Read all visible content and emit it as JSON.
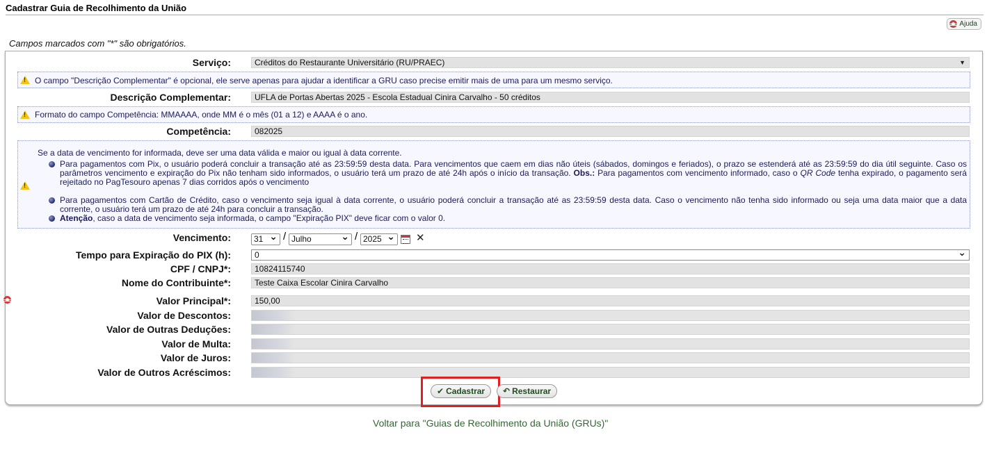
{
  "page": {
    "title": "Cadastrar Guia de Recolhimento da União",
    "help_label": "Ajuda",
    "required_note": "Campos marcados com \"*\" são obrigatórios."
  },
  "form": {
    "servico": {
      "label": "Serviço:",
      "value": "Créditos do Restaurante Universitário (RU/PRAEC)"
    },
    "info_descricao": "O campo \"Descrição Complementar\" é opcional, ele serve apenas para ajudar a identificar a GRU caso precise emitir mais de uma para um mesmo serviço.",
    "descricao": {
      "label": "Descrição Complementar:",
      "value": "UFLA de Portas Abertas 2025 - Escola Estadual Cinira Carvalho - 50 créditos"
    },
    "info_competencia": "Formato do campo Competência: MMAAAA, onde MM é o mês (01 a 12) e AAAA é o ano.",
    "competencia": {
      "label": "Competência:",
      "value": "082025"
    },
    "vencimento_info": {
      "intro": "Se a data de vencimento for informada, deve ser uma data válida e maior ou igual à data corrente.",
      "pix_a": "Para pagamentos com Pix, o usuário poderá concluir a transação até as 23:59:59 desta data. Para vencimentos que caem em dias não úteis (sábados, domingos e feriados), o prazo se estenderá até as 23:59:59 do dia útil seguinte. Caso os parâmetros vencimento e expiração do Pix não tenham sido informados, o usuário terá um prazo de até 24h após o início da transação. ",
      "pix_obs": "Obs.:",
      "pix_b": " Para pagamentos com vencimento informado, caso o ",
      "pix_qr": "QR Code",
      "pix_c": " tenha expirado, o pagamento será rejeitado no PagTesouro apenas 7 dias corridos após o vencimento",
      "cartao": "Para pagamentos com Cartão de Crédito, caso o vencimento seja igual à data corrente, o usuário poderá concluir a transação até as 23:59:59 desta data. Caso o vencimento não tenha sido informado ou seja uma data maior que a data corrente, o usuário terá um prazo de até 24h para concluir a transação.",
      "atencao_bold": "Atenção",
      "atencao_text": ", caso a data de vencimento seja informada, o campo \"Expiração PIX\" deve ficar com o valor 0."
    },
    "vencimento": {
      "label": "Vencimento:",
      "day": "31",
      "month": "Julho",
      "year": "2025",
      "separator": "/"
    },
    "expiracao_pix": {
      "label": "Tempo para Expiração do PIX (h):",
      "value": "0"
    },
    "cpf_cnpj": {
      "label": "CPF / CNPJ*:",
      "value": "10824115740"
    },
    "nome_contribuinte": {
      "label": "Nome do Contribuinte*:",
      "value": "Teste Caixa Escolar Cinira Carvalho"
    },
    "valor_principal": {
      "label": "Valor Principal*:",
      "value": "150,00"
    },
    "valor_descontos": {
      "label": "Valor de Descontos:",
      "value": ""
    },
    "valor_outras_deducoes": {
      "label": "Valor de Outras Deduções:",
      "value": ""
    },
    "valor_multa": {
      "label": "Valor de Multa:",
      "value": ""
    },
    "valor_juros": {
      "label": "Valor de Juros:",
      "value": ""
    },
    "valor_outros_acrescimos": {
      "label": "Valor de Outros Acréscimos:",
      "value": ""
    }
  },
  "buttons": {
    "cadastrar": "Cadastrar",
    "cadastrar_icon": "✔",
    "restaurar": "Restaurar",
    "restaurar_icon": "↶",
    "clear_icon": "✕"
  },
  "back_link": "Voltar para \"Guias de Recolhimento da União (GRUs)\"",
  "colors": {
    "highlight": "#e02020",
    "link": "#2f6b2f",
    "info_text": "#1b1b5a"
  },
  "icons": [
    "lifebuoy-icon",
    "warning-icon",
    "calendar-icon",
    "clear-icon",
    "check-icon",
    "undo-icon"
  ]
}
